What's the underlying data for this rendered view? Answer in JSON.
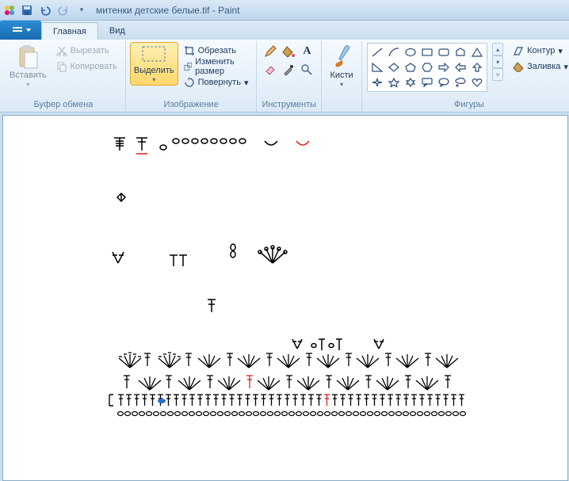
{
  "titlebar": {
    "filename": "митенки детские белые.tif - Paint"
  },
  "tabs": {
    "home": "Главная",
    "view": "Вид"
  },
  "ribbon": {
    "clipboard": {
      "label": "Буфер обмена",
      "paste": "Вставить",
      "cut": "Вырезать",
      "copy": "Копировать"
    },
    "image": {
      "label": "Изображение",
      "select": "Выделить",
      "crop": "Обрезать",
      "resize": "Изменить размер",
      "rotate": "Повернуть"
    },
    "tools": {
      "label": "Инструменты"
    },
    "brushes": {
      "label": "Кисти"
    },
    "shapes": {
      "label": "Фигуры",
      "outline": "Контур",
      "fill": "Заливка"
    }
  }
}
